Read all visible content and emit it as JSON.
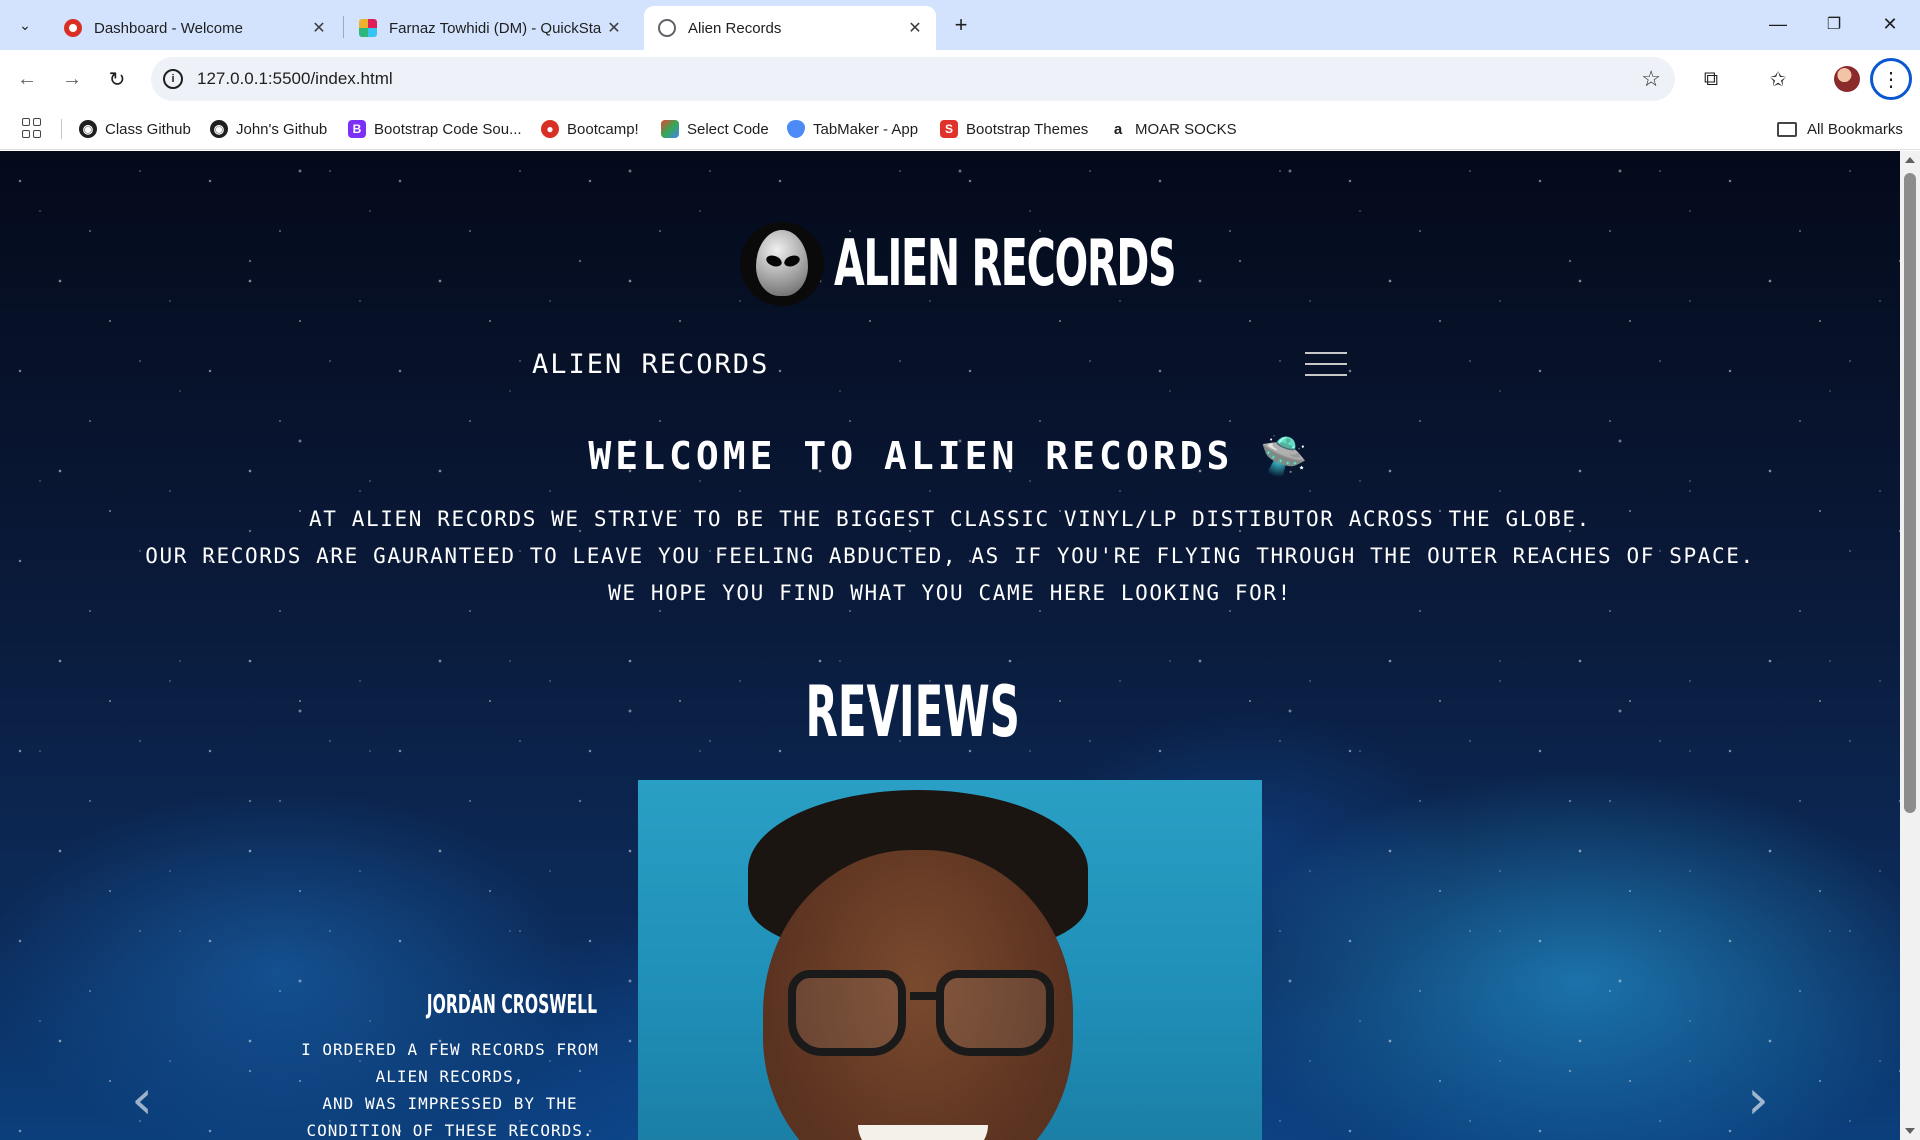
{
  "browser": {
    "tabs": [
      {
        "title": "Dashboard - Welcome",
        "favicon": "bootcamp-icon",
        "active": false
      },
      {
        "title": "Farnaz Towhidi (DM) - QuickSta",
        "favicon": "slack-icon",
        "active": false
      },
      {
        "title": "Alien Records",
        "favicon": "globe-icon",
        "active": true
      }
    ],
    "url": "127.0.0.1:5500/index.html",
    "bookmarks": [
      {
        "label": "Class Github",
        "icon": "github-icon"
      },
      {
        "label": "John's Github",
        "icon": "github-icon"
      },
      {
        "label": "Bootstrap Code Sou...",
        "icon": "bootstrap-icon"
      },
      {
        "label": "Bootcamp!",
        "icon": "bootcamp-icon"
      },
      {
        "label": "Select Code",
        "icon": "cube-icon"
      },
      {
        "label": "TabMaker - App",
        "icon": "shield-icon"
      },
      {
        "label": "Bootstrap Themes",
        "icon": "s-icon"
      },
      {
        "label": "MOAR SOCKS",
        "icon": "amazon-icon"
      }
    ],
    "all_bookmarks_label": "All Bookmarks"
  },
  "page": {
    "logo_text": "ALIEN RECORDS",
    "navbar_brand": "Alien Records",
    "welcome_heading": "Welcome to Alien Records",
    "welcome_emoji": "🛸",
    "intro_lines": [
      "At Alien Records we strive to be the biggest classic vinyl/LP distibutor across the globe.",
      "Our records are gauranteed to leave you feeling abducted, as if you're flying through the outer reaches of space.",
      "We hope you find what you came here looking for!"
    ],
    "reviews_heading": "REVIEWS",
    "review": {
      "name": "JORDAN CROSWELL",
      "text_lines": [
        "I ordered a few records from",
        "Alien Records,",
        "and was impressed by the",
        "condition of these records."
      ]
    }
  },
  "colors": {
    "tabstrip": "#d3e3fd",
    "accent": "#0b57d0",
    "page_text": "#ffffff",
    "space_dark": "#040a1a",
    "space_blue": "#0b3f7c"
  }
}
